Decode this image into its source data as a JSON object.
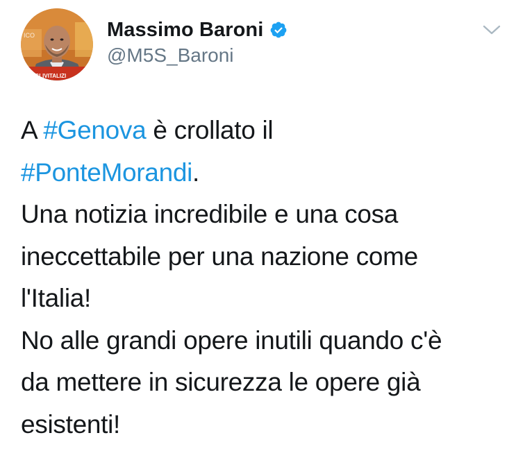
{
  "tweet": {
    "author": {
      "display_name": "Massimo Baroni",
      "handle": "@M5S_Baroni",
      "verified": true,
      "avatar_banner_text": "TAGLIVITALIZI"
    },
    "body": {
      "line1": {
        "pre": "A ",
        "hashtag": "#Genova",
        "post": " è crollato il"
      },
      "line2": {
        "hashtag": "#PonteMorandi",
        "post": "."
      },
      "line3": "Una notizia incredibile e una cosa",
      "line4": "ineccettabile per una nazione come",
      "line5": "l'Italia!",
      "line6": "No alle grandi opere inutili quando c'è",
      "line7": "da mettere in sicurezza le opere già",
      "line8": "esistenti!"
    }
  },
  "icons": {
    "verified": "verified-badge-icon",
    "menu": "chevron-down-icon"
  },
  "colors": {
    "text": "#14171a",
    "handle": "#657786",
    "link": "#1b95e0",
    "verified": "#1da1f2",
    "chevron": "#aab8c2"
  }
}
